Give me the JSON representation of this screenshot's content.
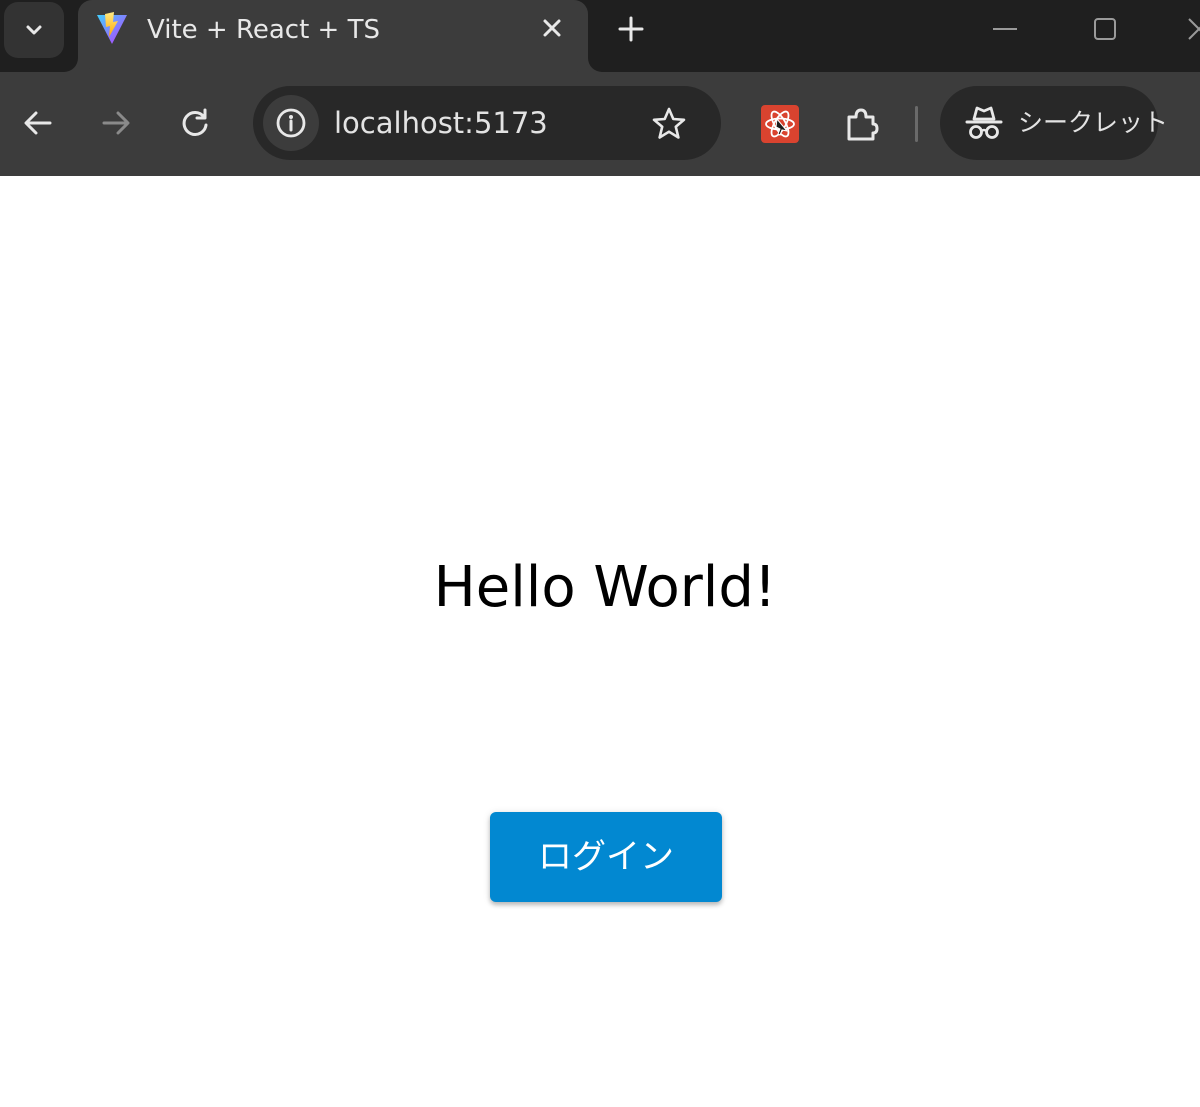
{
  "browser": {
    "tab": {
      "title": "Vite + React + TS",
      "favicon": "vite-logo-icon"
    },
    "toolbar": {
      "url": "localhost:5173",
      "incognito_label": "シークレット"
    },
    "icons": {
      "tab_search": "chevron-down-icon",
      "tab_close": "close-icon",
      "new_tab": "plus-icon",
      "back": "arrow-left-icon",
      "forward": "arrow-right-icon",
      "reload": "reload-icon",
      "site_info": "info-icon",
      "bookmark": "star-icon",
      "react_devtools": "react-devtools-icon",
      "extensions": "puzzle-icon",
      "incognito": "incognito-icon"
    },
    "colors": {
      "tabstrip_bg": "#1f1f1f",
      "toolbar_bg": "#3c3c3c",
      "omnibox_bg": "#282828"
    }
  },
  "page": {
    "heading": "Hello World!",
    "login_button": "ログイン",
    "colors": {
      "login_button_bg": "#0288d1",
      "login_button_text": "#ffffff"
    }
  }
}
